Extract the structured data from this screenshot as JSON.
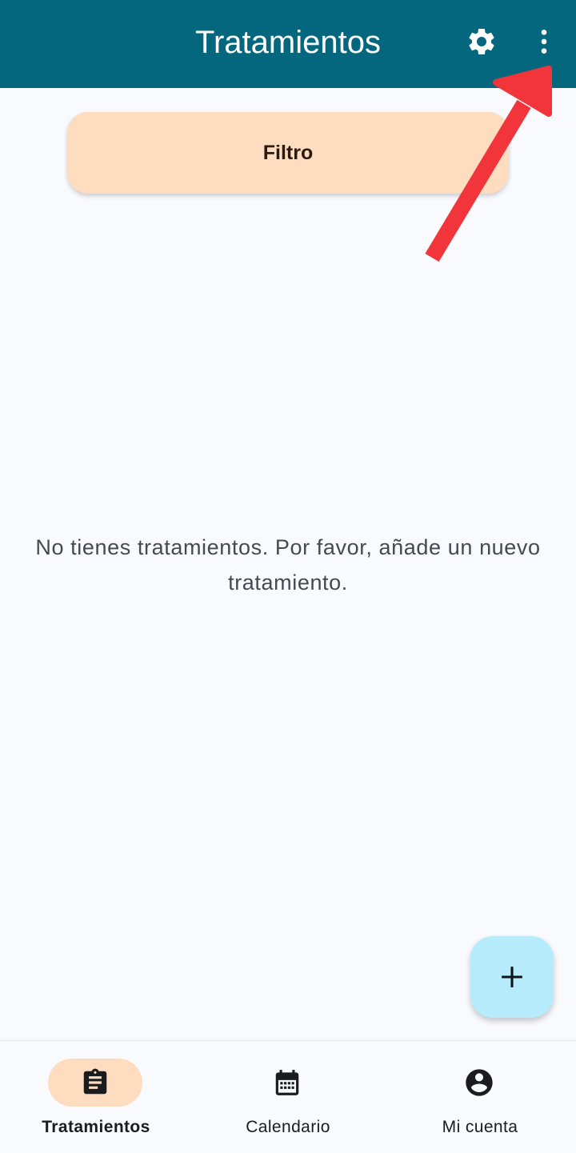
{
  "appbar": {
    "title": "Tratamientos",
    "background_color": "#05677d",
    "settings_icon": "gear-icon",
    "more_icon": "more-vert-icon"
  },
  "filter": {
    "label": "Filtro",
    "background_color": "#fddcc0"
  },
  "empty_state": {
    "message": "No tienes tratamientos. Por favor, añade un nuevo tratamiento."
  },
  "fab": {
    "icon": "plus-icon",
    "background_color": "#b6ebfb"
  },
  "bottom_nav": {
    "items": [
      {
        "label": "Tratamientos",
        "icon": "clipboard-icon",
        "active": true
      },
      {
        "label": "Calendario",
        "icon": "calendar-icon",
        "active": false
      },
      {
        "label": "Mi cuenta",
        "icon": "account-circle-icon",
        "active": false
      }
    ],
    "active_indicator_color": "#fddcc0"
  },
  "annotation": {
    "arrow_color": "#f2353b"
  }
}
